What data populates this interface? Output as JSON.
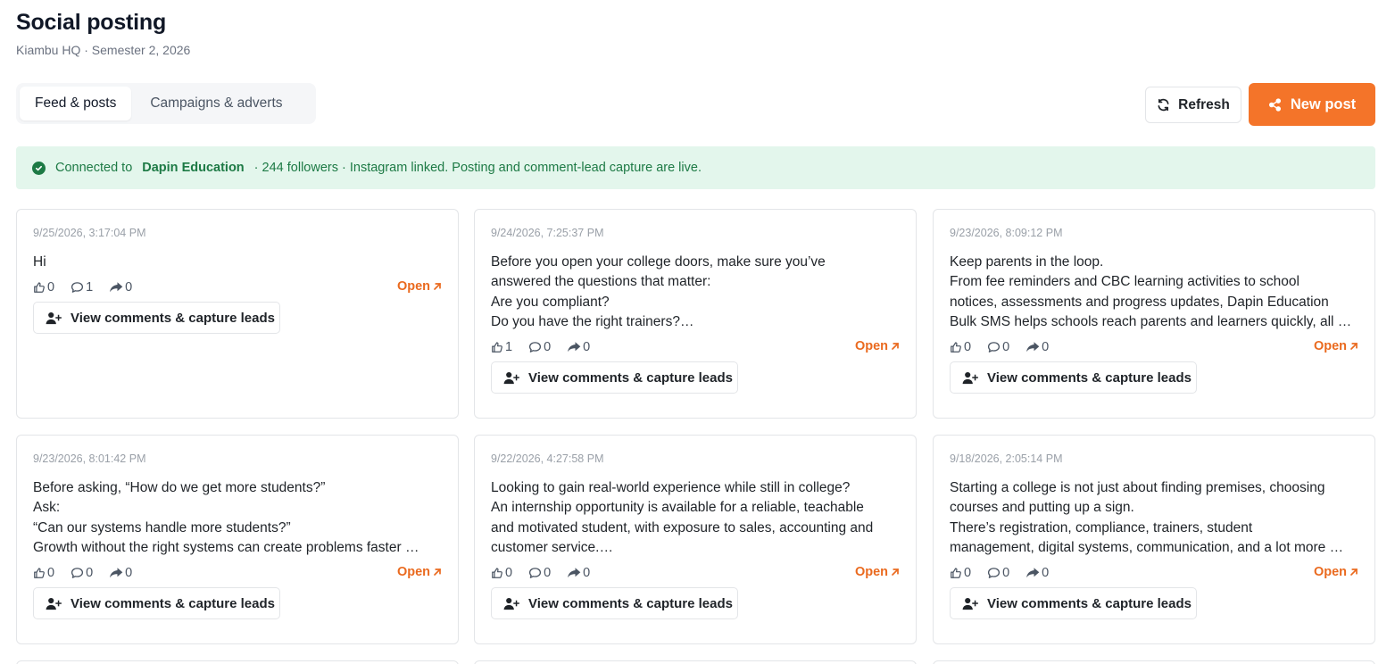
{
  "header": {
    "title": "Social posting",
    "subtitle": "Kiambu HQ · Semester 2, 2026"
  },
  "tabs": [
    {
      "label": "Feed & posts",
      "active": true
    },
    {
      "label": "Campaigns & adverts",
      "active": false
    }
  ],
  "actions": {
    "refresh_label": "Refresh",
    "new_post_label": "New post"
  },
  "banner": {
    "prefix": "Connected to",
    "org": "Dapin Education",
    "suffix": "· 244 followers · Instagram linked. Posting and comment-lead capture are live."
  },
  "posts": [
    {
      "timestamp": "9/25/2026, 3:17:04 PM",
      "text": "Hi",
      "likes": "0",
      "comments": "1",
      "shares": "0",
      "open_label": "Open",
      "lead_label": "View comments & capture leads"
    },
    {
      "timestamp": "9/24/2026, 7:25:37 PM",
      "text": "Before you open your college doors, make sure you’ve\nanswered the questions that matter:\nAre you compliant?\nDo you have the right trainers?…",
      "likes": "1",
      "comments": "0",
      "shares": "0",
      "open_label": "Open",
      "lead_label": "View comments & capture leads"
    },
    {
      "timestamp": "9/23/2026, 8:09:12 PM",
      "text": "Keep parents in the loop.\nFrom fee reminders and CBC learning activities to school\nnotices, assessments and progress updates, Dapin Education\nBulk SMS helps schools reach parents and learners quickly, all …",
      "likes": "0",
      "comments": "0",
      "shares": "0",
      "open_label": "Open",
      "lead_label": "View comments & capture leads"
    },
    {
      "timestamp": "9/23/2026, 8:01:42 PM",
      "text": "Before asking, “How do we get more students?”\nAsk:\n“Can our systems handle more students?”\nGrowth without the right systems can create problems faster …",
      "likes": "0",
      "comments": "0",
      "shares": "0",
      "open_label": "Open",
      "lead_label": "View comments & capture leads"
    },
    {
      "timestamp": "9/22/2026, 4:27:58 PM",
      "text": "Looking to gain real-world experience while still in college?\nAn internship opportunity is available for a reliable, teachable\nand motivated student, with exposure to sales, accounting and\ncustomer service.…",
      "likes": "0",
      "comments": "0",
      "shares": "0",
      "open_label": "Open",
      "lead_label": "View comments & capture leads"
    },
    {
      "timestamp": "9/18/2026, 2:05:14 PM",
      "text": "Starting a college is not just about finding premises, choosing\ncourses and putting up a sign.\nThere’s registration, compliance, trainers, student\nmanagement, digital systems, communication, and a lot more …",
      "likes": "0",
      "comments": "0",
      "shares": "0",
      "open_label": "Open",
      "lead_label": "View comments & capture leads"
    }
  ],
  "colors": {
    "accent": "#f47429",
    "success_bg": "#e3f6ec",
    "success_text": "#1d7a45"
  }
}
